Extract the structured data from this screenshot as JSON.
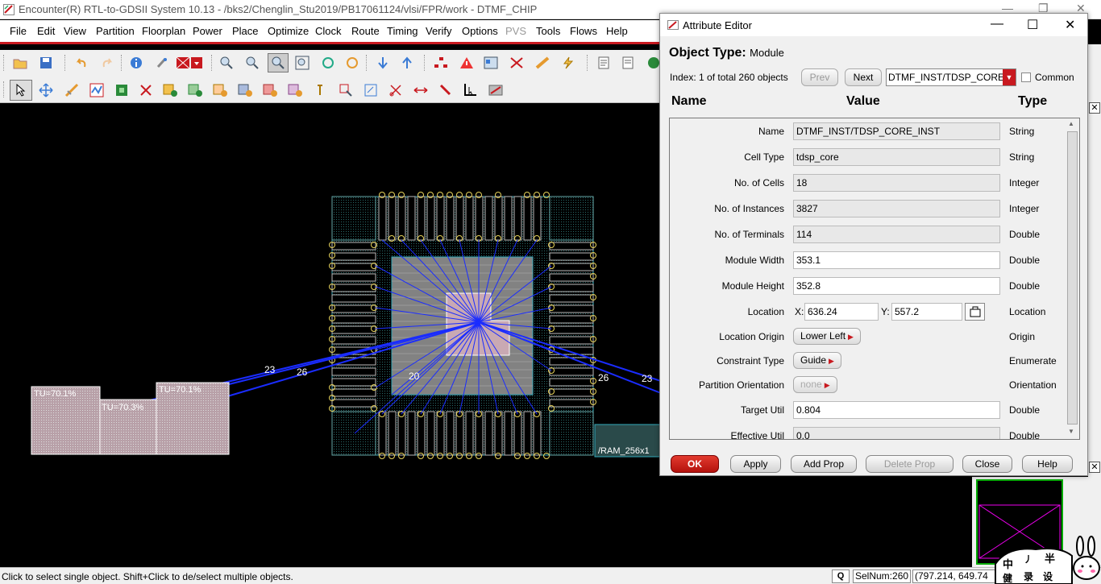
{
  "window": {
    "title": "Encounter(R) RTL-to-GDSII System 10.13 - /bks2/Chenglin_Stu2019/PB17061124/vlsi/FPR/work - DTMF_CHIP"
  },
  "menu": [
    "File",
    "Edit",
    "View",
    "Partition",
    "Floorplan",
    "Power",
    "Place",
    "Optimize",
    "Clock",
    "Route",
    "Timing",
    "Verify",
    "Options",
    "PVS",
    "Tools",
    "Flows",
    "Help"
  ],
  "canvas": {
    "labels": {
      "n23a": "23",
      "n26a": "26",
      "n20": "20",
      "n26b": "26",
      "n23b": "23",
      "tu1": "TU=70.1%",
      "tu2": "TU=70.3%",
      "tu3": "TU=70.1%",
      "ram": "/RAM_256x1"
    }
  },
  "status": {
    "message": "Click to select single object. Shift+Click to de/select multiple objects.",
    "q": "Q",
    "selnum": "SelNum:260",
    "coords": "(797.214, 649.74"
  },
  "dialog": {
    "title": "Attribute Editor",
    "object_type_label": "Object Type:",
    "object_type_value": "Module",
    "index_text": "Index: 1 of total 260 objects",
    "prev": "Prev",
    "next": "Next",
    "combo_value": "DTMF_INST/TDSP_CORE",
    "common": "Common",
    "col_name": "Name",
    "col_value": "Value",
    "col_type": "Type",
    "rows": [
      {
        "name": "Name",
        "value": "DTMF_INST/TDSP_CORE_INST",
        "type": "String"
      },
      {
        "name": "Cell Type",
        "value": "tdsp_core",
        "type": "String"
      },
      {
        "name": "No. of Cells",
        "value": "18",
        "type": "Integer"
      },
      {
        "name": "No. of Instances",
        "value": "3827",
        "type": "Integer"
      },
      {
        "name": "No. of Terminals",
        "value": "114",
        "type": "Double"
      },
      {
        "name": "Module Width",
        "value": "353.1",
        "type": "Double"
      },
      {
        "name": "Module Height",
        "value": "352.8",
        "type": "Double"
      }
    ],
    "location": {
      "name": "Location",
      "x_label": "X:",
      "x": "636.24",
      "y_label": "Y:",
      "y": "557.2",
      "type": "Location"
    },
    "location_origin": {
      "name": "Location Origin",
      "value": "Lower Left",
      "type": "Origin"
    },
    "constraint_type": {
      "name": "Constraint Type",
      "value": "Guide",
      "type": "Enumerate"
    },
    "partition_orientation": {
      "name": "Partition Orientation",
      "value": "none",
      "type": "Orientation"
    },
    "target_util": {
      "name": "Target Util",
      "value": "0.804",
      "type": "Double"
    },
    "effective_util": {
      "name": "Effective Util",
      "value": "0.0",
      "type": "Double"
    },
    "buttons": {
      "ok": "OK",
      "apply": "Apply",
      "add_prop": "Add Prop",
      "delete_prop": "Delete Prop",
      "close": "Close",
      "help": "Help"
    }
  }
}
